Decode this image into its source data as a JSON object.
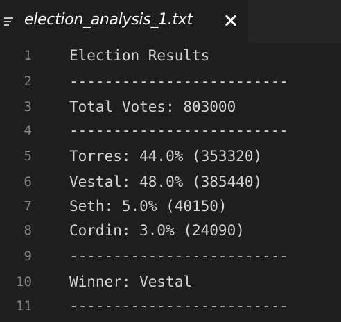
{
  "tab": {
    "icon": "lines-icon",
    "title": "election_analysis_1.txt",
    "close_icon": "close-icon"
  },
  "editor": {
    "lines": [
      {
        "number": "1",
        "text": "Election Results"
      },
      {
        "number": "2",
        "text": "-------------------------"
      },
      {
        "number": "3",
        "text": "Total Votes: 803000"
      },
      {
        "number": "4",
        "text": "-------------------------"
      },
      {
        "number": "5",
        "text": "Torres: 44.0% (353320)"
      },
      {
        "number": "6",
        "text": "Vestal: 48.0% (385440)"
      },
      {
        "number": "7",
        "text": "Seth: 5.0% (40150)"
      },
      {
        "number": "8",
        "text": "Cordin: 3.0% (24090)"
      },
      {
        "number": "9",
        "text": "-------------------------"
      },
      {
        "number": "10",
        "text": "Winner: Vestal"
      },
      {
        "number": "11",
        "text": "-------------------------"
      }
    ]
  },
  "colors": {
    "editor_background": "#1e1e1e",
    "tabbar_background": "#252526",
    "text": "#d4d4d4",
    "line_number": "#858585"
  }
}
